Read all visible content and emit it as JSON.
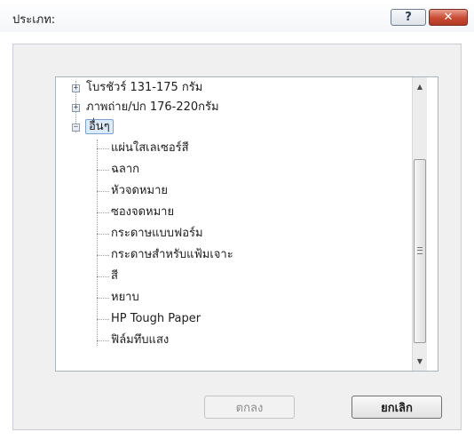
{
  "dialog": {
    "title": "ประเภท:",
    "help_label": "?",
    "close_label": "✕"
  },
  "tree": {
    "items": [
      {
        "label": "โบรชัวร์ 131-175 กรัม",
        "expander": "+"
      },
      {
        "label": "ภาพถ่าย/ปก 176-220กรัม",
        "expander": "+"
      },
      {
        "label": "อื่นๆ",
        "expander": "−",
        "selected": true
      },
      {
        "label": "แผ่นใสเลเซอร์สี"
      },
      {
        "label": "ฉลาก"
      },
      {
        "label": "หัวจดหมาย"
      },
      {
        "label": "ซองจดหมาย"
      },
      {
        "label": "กระดาษแบบฟอร์ม"
      },
      {
        "label": "กระดาษสำหรับแฟ้มเจาะ"
      },
      {
        "label": "สี"
      },
      {
        "label": "หยาบ"
      },
      {
        "label": "HP Tough Paper"
      },
      {
        "label": "ฟิล์มทึบแสง"
      }
    ]
  },
  "scrollbar": {
    "up_icon": "▲",
    "down_icon": "▼"
  },
  "buttons": {
    "ok_label": "ตกลง",
    "cancel_label": "ยกเลิก"
  }
}
